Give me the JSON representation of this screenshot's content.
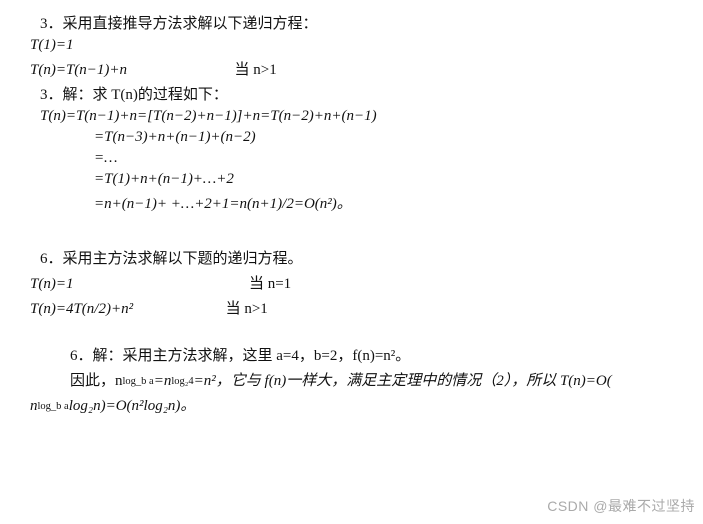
{
  "problem3": {
    "heading": "3．采用直接推导方法求解以下递归方程：",
    "eq1": "T(1)=1",
    "eq2_lhs": "T(n)=T(n−1)+n",
    "eq2_cond": "当 n>1",
    "solution_heading": "3．解：求 T(n)的过程如下：",
    "step1": "T(n)=T(n−1)+n=[T(n−2)+n−1)]+n=T(n−2)+n+(n−1)",
    "step2": "=T(n−3)+n+(n−1)+(n−2)",
    "step3": "=…",
    "step4": "=T(1)+n+(n−1)+…+2",
    "step5": "=n+(n−1)+ +…+2+1=n(n+1)/2=O(n²)。"
  },
  "problem6": {
    "heading": "6．采用主方法求解以下题的递归方程。",
    "eq1_lhs": "T(n)=1",
    "eq1_cond": "当 n=1",
    "eq2_lhs": "T(n)=4T(n/2)+n²",
    "eq2_cond": "当 n>1",
    "solution_heading": "6．解：采用主方法求解，这里 a=4，b=2，f(n)=n²。",
    "line2_a": "因此，n",
    "exp1_top": "log_b a",
    "line2_b": "=n",
    "exp2_top": "log₂4",
    "line2_c": "=n²，它与 f(n)一样大，满足主定理中的情况（2），所以 T(n)=O(",
    "line3_a": "n",
    "exp3_top": "log_b a",
    "line3_b": "log₂n)=O(n²log₂n)。"
  },
  "watermark": "CSDN @最难不过坚持"
}
